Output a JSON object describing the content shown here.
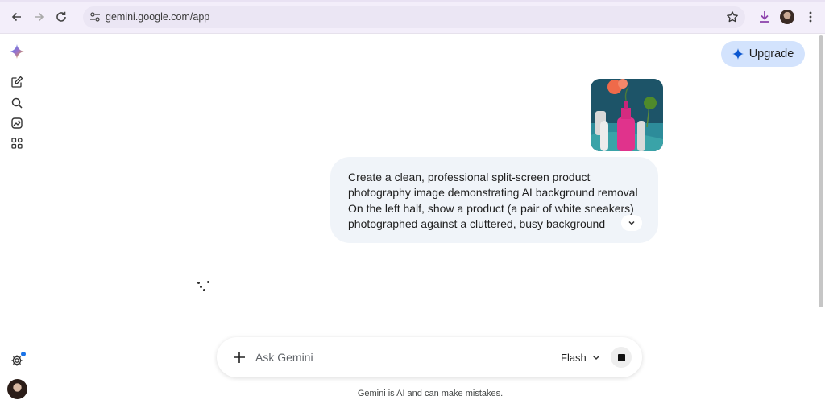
{
  "browser": {
    "url": "gemini.google.com/app"
  },
  "sidebar": {
    "items": [
      {
        "name": "new-chat",
        "icon": "edit-icon"
      },
      {
        "name": "search",
        "icon": "search-icon"
      },
      {
        "name": "gallery",
        "icon": "image-library-icon"
      },
      {
        "name": "apps",
        "icon": "apps-icon"
      }
    ],
    "settings_icon": "gear-icon"
  },
  "header": {
    "upgrade_label": "Upgrade"
  },
  "conversation": {
    "prompt_lines": [
      "Create a clean, professional split-screen product",
      "photography image demonstrating AI background removal.",
      "On the left half, show a product (a pair of white sneakers)",
      "photographed against a cluttered, busy background",
      "— a"
    ]
  },
  "input": {
    "placeholder": "Ask Gemini",
    "model_label": "Flash"
  },
  "footer": {
    "disclaimer": "Gemini is AI and can make mistakes."
  },
  "colors": {
    "accent": "#1a73e8",
    "upgrade_bg": "#d3e3fd",
    "bubble_bg": "#f0f4f9",
    "browser_chrome": "#f3eefa"
  }
}
